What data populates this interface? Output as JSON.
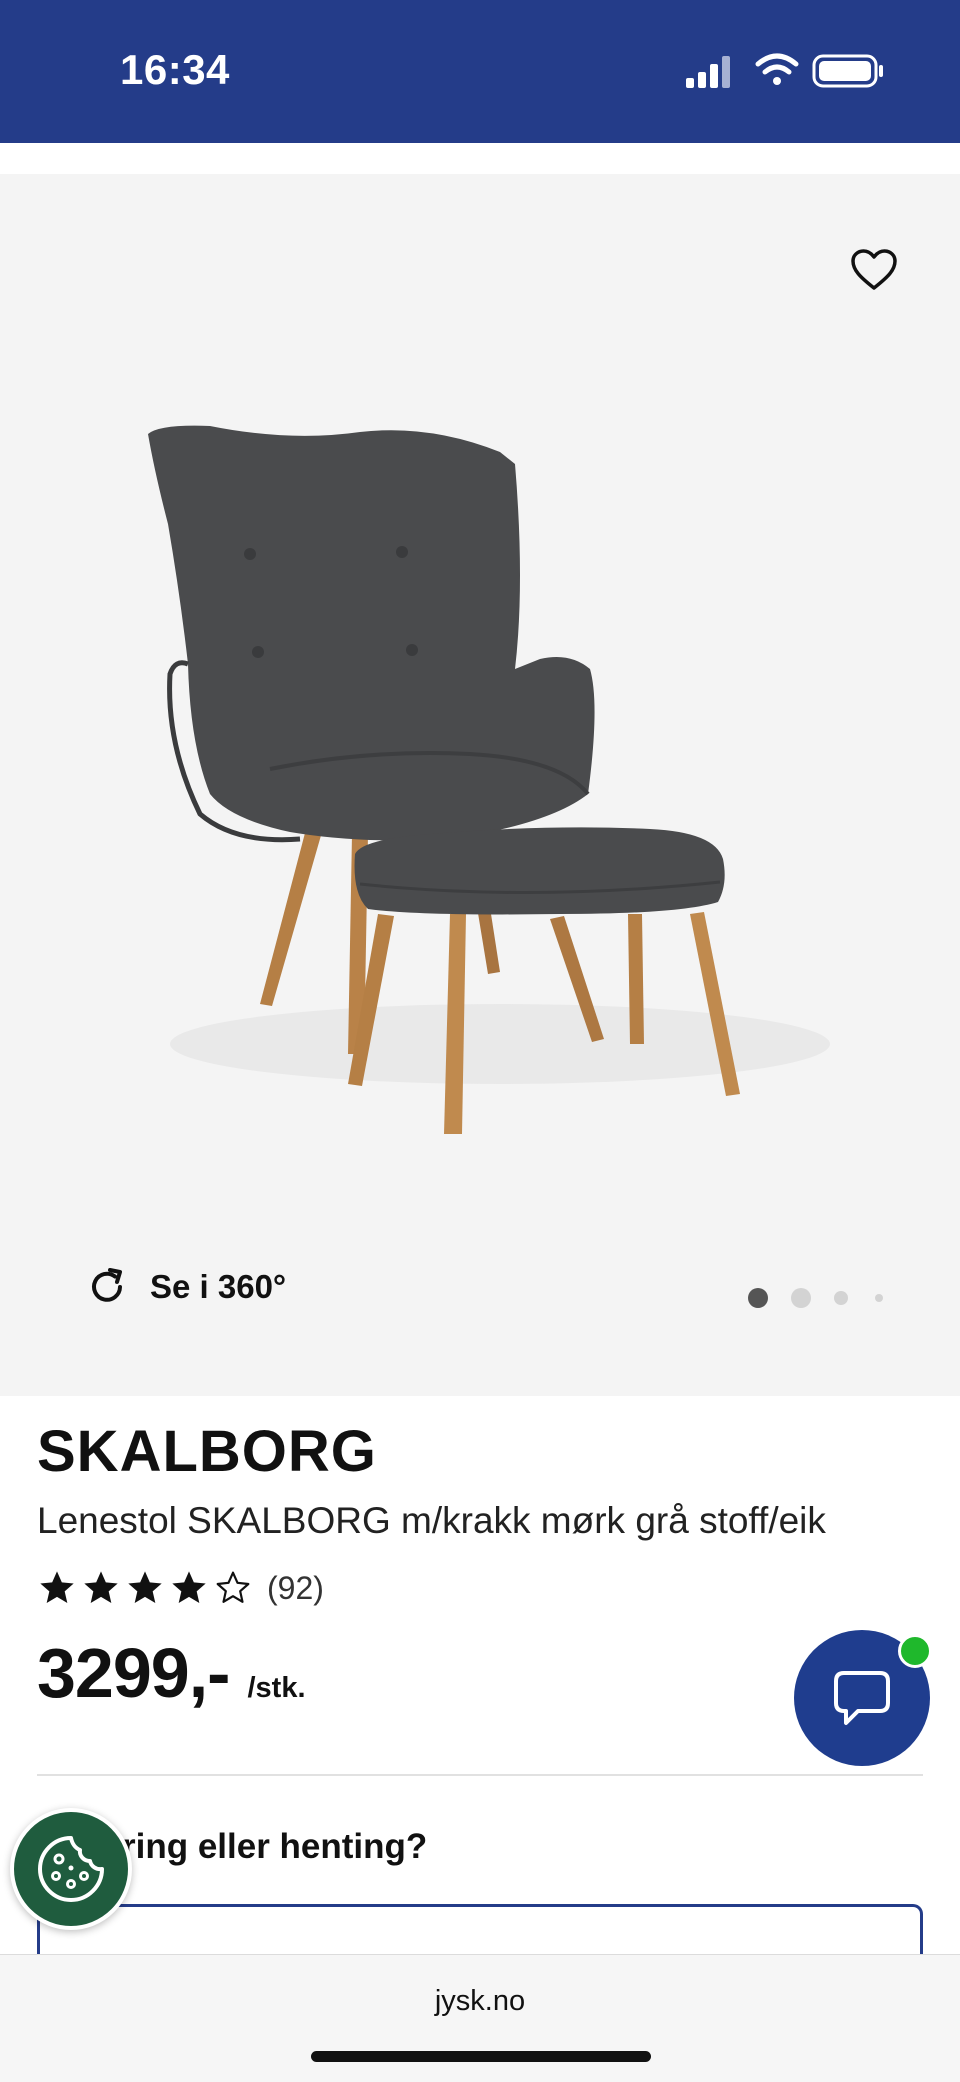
{
  "status_bar": {
    "time": "16:34",
    "signal_icon": "signal-bars-icon",
    "wifi_icon": "wifi-icon",
    "battery_icon": "battery-icon",
    "background": "#243c89"
  },
  "gallery": {
    "wishlist_icon": "heart-outline-icon",
    "image_subject": "dark grey wingback armchair with matching footstool on oak legs",
    "view_360_icon": "rotate-icon",
    "view_360_label": "Se i 360°",
    "page_count": 4,
    "current_page": 1
  },
  "product": {
    "brand": "SKALBORG",
    "title": "Lenestol SKALBORG m/krakk mørk grå stoff/eik",
    "rating": 4,
    "rating_max": 5,
    "review_count": "(92)",
    "price": "3299,-",
    "unit": "/stk."
  },
  "chat": {
    "icon": "chat-bubble-icon",
    "online_color": "#1fb82c",
    "button_color": "#1f3d8e"
  },
  "delivery": {
    "question_visible": "ring eller henting?"
  },
  "cookie": {
    "icon": "cookie-icon",
    "color": "#1f5c3e"
  },
  "browser": {
    "url": "jysk.no"
  }
}
